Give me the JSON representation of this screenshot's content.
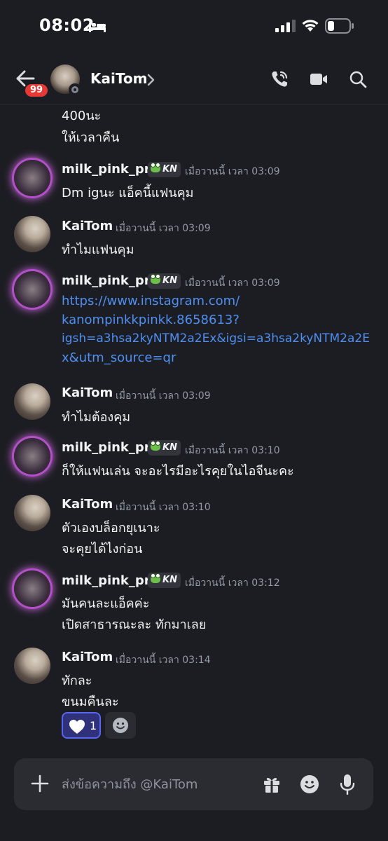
{
  "status_bar": {
    "time": "08:02"
  },
  "header": {
    "title": "KaiTom",
    "unread_badge": "99"
  },
  "messages": {
    "m0": {
      "lines": [
        "400นะ",
        "ให้เวลาคืน"
      ]
    },
    "m1": {
      "author": "milk_pink_pr",
      "tag": "KN",
      "timestamp": "เมื่อวานนี้ เวลา 03:09",
      "lines": [
        "Dm igนะ แอ็คนี้แฟนคุม"
      ]
    },
    "m2": {
      "author": "KaiTom",
      "timestamp": "เมื่อวานนี้ เวลา 03:09",
      "lines": [
        "ทำไมแฟนคุม"
      ]
    },
    "m3": {
      "author": "milk_pink_pr",
      "tag": "KN",
      "timestamp": "เมื่อวานนี้ เวลา 03:09",
      "lines": [
        "https://www.instagram.com/",
        "kanompinkkpinkk.8658613?",
        "igsh=a3hsa2kyNTM2a2Ex&igsi=a3hsa2kyNTM2a2E",
        "x&utm_source=qr"
      ]
    },
    "m4": {
      "author": "KaiTom",
      "timestamp": "เมื่อวานนี้ เวลา 03:09",
      "lines": [
        "ทำไมต้องคุม"
      ]
    },
    "m5": {
      "author": "milk_pink_pr",
      "tag": "KN",
      "timestamp": "เมื่อวานนี้ เวลา 03:10",
      "lines": [
        "ก็ให้แฟนเล่น จะอะไรมีอะไรคุยในไอจีนะคะ"
      ]
    },
    "m6": {
      "author": "KaiTom",
      "timestamp": "เมื่อวานนี้ เวลา 03:10",
      "lines": [
        "ตัวเองบล็อกยุเนาะ",
        "จะคุยได้ไงก่อน"
      ]
    },
    "m7": {
      "author": "milk_pink_pr",
      "tag": "KN",
      "timestamp": "เมื่อวานนี้ เวลา 03:12",
      "lines": [
        "มันคนละแอ็คค่ะ",
        "เปิดสาธารณะละ ทักมาเลย"
      ]
    },
    "m8": {
      "author": "KaiTom",
      "timestamp": "เมื่อวานนี้ เวลา 03:14",
      "lines": [
        "ทักละ",
        "ขนมคืนละ"
      ]
    }
  },
  "reaction": {
    "emoji": "heart-white",
    "count": "1"
  },
  "composer": {
    "placeholder": "ส่งข้อความถึง @KaiTom"
  },
  "colors": {
    "background": "#1c1d22",
    "link": "#4f8ff2",
    "reaction_active": "#5865f2",
    "badge": "#e53935"
  }
}
